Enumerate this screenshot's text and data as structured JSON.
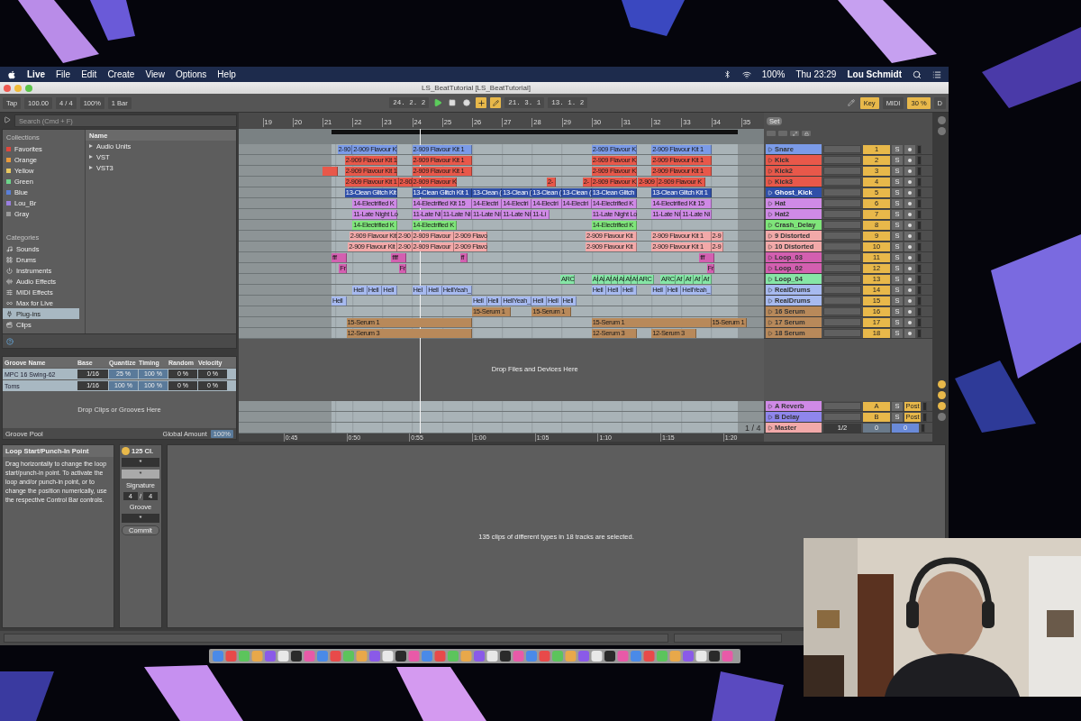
{
  "menu_bar": {
    "items": [
      "Live",
      "File",
      "Edit",
      "Create",
      "View",
      "Options",
      "Help"
    ],
    "battery": "100%",
    "clock": "Thu 23:29",
    "user": "Lou Schmidt"
  },
  "window": {
    "title": "LS_BeatTutorial  [LS_BeatTutorial]"
  },
  "control_bar": {
    "tap": "Tap",
    "tempo": "100.00",
    "signature": "4 / 4",
    "zoom": "100%",
    "quantize": "1 Bar",
    "position": "24. 2. 2",
    "loop_start": "21. 3. 1",
    "loop_length": "13. 1. 2",
    "key": "Key",
    "midi": "MIDI",
    "cpu": "30 %",
    "disk": "D"
  },
  "browser": {
    "search": {
      "placeholder": "Search (Cmd + F)"
    },
    "collections_title": "Collections",
    "collections": [
      {
        "label": "Favorites",
        "color": "#e0473c"
      },
      {
        "label": "Orange",
        "color": "#e89a3c"
      },
      {
        "label": "Yellow",
        "color": "#e8c860"
      },
      {
        "label": "Green",
        "color": "#6cd58a"
      },
      {
        "label": "Blue",
        "color": "#5a7fd8"
      },
      {
        "label": "Lou_Br",
        "color": "#9a7fe0"
      },
      {
        "label": "Gray",
        "color": "#9a9a9a"
      }
    ],
    "categories_title": "Categories",
    "categories": [
      {
        "label": "Sounds",
        "selected": false
      },
      {
        "label": "Drums",
        "selected": false
      },
      {
        "label": "Instruments",
        "selected": false
      },
      {
        "label": "Audio Effects",
        "selected": false
      },
      {
        "label": "MIDI Effects",
        "selected": false
      },
      {
        "label": "Max for Live",
        "selected": false
      },
      {
        "label": "Plug-ins",
        "selected": true
      },
      {
        "label": "Clips",
        "selected": false
      }
    ],
    "name_header": "Name",
    "items": [
      "Audio Units",
      "VST",
      "VST3"
    ]
  },
  "groove_pool": {
    "columns": [
      "Groove Name",
      "Base",
      "Quantize",
      "Timing",
      "Random",
      "Velocity"
    ],
    "rows": [
      {
        "name": "MPC 16 Swing-62",
        "base": "1/16",
        "quantize": "25 %",
        "timing": "100 %",
        "random": "0 %",
        "velocity": "0 %"
      },
      {
        "name": "Toms",
        "base": "1/16",
        "quantize": "100 %",
        "timing": "100 %",
        "random": "0 %",
        "velocity": "0 %"
      }
    ],
    "drop_hint": "Drop Clips or Grooves Here",
    "title": "Groove Pool",
    "global_amount_label": "Global Amount",
    "global_amount": "100%"
  },
  "arrangement": {
    "ruler": [
      "19",
      "20",
      "21",
      "22",
      "23",
      "24",
      "25",
      "26",
      "27",
      "28",
      "29",
      "30",
      "31",
      "32",
      "33",
      "34",
      "35"
    ],
    "set_button": "Set",
    "drop_hint": "Drop Files and Devices Here",
    "zoom_label": "1 / 4",
    "time_ruler": [
      "0:45",
      "0:50",
      "0:55",
      "1:00",
      "1:05",
      "1:10",
      "1:15",
      "1:20"
    ],
    "tracks": [
      {
        "name": "Snare",
        "number": "1",
        "solo": "S",
        "color": "#7b9be8",
        "clips": [
          {
            "name": "2-90"
          },
          {
            "name": "2-909 Flavour K"
          },
          {
            "name": "2-909 Flavour Kit 1"
          },
          {
            "name": "2-909 Flavour K"
          },
          {
            "name": "2-909 Flavour Kit 1"
          }
        ]
      },
      {
        "name": "Kick",
        "number": "2",
        "solo": "S",
        "color": "#e8584a",
        "clips": [
          {
            "name": "2-909 Flavour Kit 1"
          },
          {
            "name": "2-909 Flavour Kit 1"
          },
          {
            "name": "2-909 Flavour K"
          },
          {
            "name": "2-909 Flavour Kit 1"
          }
        ]
      },
      {
        "name": "Kick2",
        "number": "3",
        "solo": "S",
        "color": "#e8584a",
        "clips": [
          {
            "kind": "blank"
          },
          {
            "kind": "named",
            "name": "2-909 Flavour Kit 1"
          },
          {
            "kind": "named",
            "name": "2-909 Flavour Kit 1"
          },
          {
            "kind": "named",
            "name": "2-909 Flavour K"
          },
          {
            "kind": "named",
            "name": "2-909 Flavour Kit 1"
          }
        ]
      },
      {
        "name": "Kick3",
        "number": "4",
        "solo": "S",
        "color": "#e8584a",
        "clips": [
          {
            "name": "2-909 Flavour Kit 1"
          },
          {
            "name": "2-90"
          },
          {
            "name": "2-909 Flavour K"
          },
          {
            "name": "2-"
          },
          {
            "name": "2-"
          },
          {
            "name": "2-909 Flavour K"
          },
          {
            "name": "2-909"
          },
          {
            "name": "2-909 Flavour K"
          }
        ]
      },
      {
        "name": "Ghost_Kick",
        "number": "5",
        "solo": "S",
        "color": "#2f4fa8",
        "clips": [
          {
            "name": "13-Clean Glitch Kit"
          },
          {
            "name": "13-Clean Glitch Kit 1"
          },
          {
            "name": "13-Clean ("
          },
          {
            "name": "13-Clean ("
          },
          {
            "name": "13-Clean ("
          },
          {
            "name": "13-Clean ("
          },
          {
            "name": "13-Clean Glitch"
          },
          {
            "name": "13-Clean Glitch Kit 1"
          }
        ]
      },
      {
        "name": "Hat",
        "number": "6",
        "solo": "S",
        "color": "#cf8ae6",
        "clips": [
          {
            "name": "14-Electrified K"
          },
          {
            "name": "14-Electrified Kit 15"
          },
          {
            "name": "14-Electri"
          },
          {
            "name": "14-Electri"
          },
          {
            "name": "14-Electri"
          },
          {
            "name": "14-Electri"
          },
          {
            "name": "14-Electrified K"
          },
          {
            "name": "14-Electrified Kit 15"
          }
        ]
      },
      {
        "name": "Hat2",
        "number": "7",
        "solo": "S",
        "color": "#cf8ae6",
        "clips": [
          {
            "name": "11-Late Night Lo"
          },
          {
            "name": "11-Late Ni"
          },
          {
            "name": "11-Late Ni"
          },
          {
            "name": "11-Late Ni"
          },
          {
            "name": "11-Late Ni"
          },
          {
            "name": "11-Li"
          },
          {
            "name": "11-Late Night Lo"
          },
          {
            "name": "11-Late Ni"
          },
          {
            "name": "11-Late Ni"
          }
        ]
      },
      {
        "name": "Crash_Delay",
        "number": "8",
        "solo": "S",
        "color": "#7fe57a",
        "clips": [
          {
            "name": "14-Electrified K"
          },
          {
            "name": "14-Electrified K"
          },
          {
            "name": "14-Electrified K"
          }
        ]
      },
      {
        "name": "9 Distorted",
        "number": "9",
        "solo": "S",
        "color": "#f2a9a9",
        "clips": [
          {
            "name": "2-909 Flavour Kit"
          },
          {
            "name": "2-90"
          },
          {
            "name": "2-909 Flavour"
          },
          {
            "name": "2-909 Flavo"
          },
          {
            "name": "2-909 Flavour Kit"
          },
          {
            "name": "2-909 Flavour Kit 1"
          },
          {
            "name": "2-9"
          }
        ]
      },
      {
        "name": "10 Distorted",
        "number": "10",
        "solo": "S",
        "color": "#f2a9a9",
        "clips": [
          {
            "name": "2-909 Flavour Kit"
          },
          {
            "name": "2-90"
          },
          {
            "name": "2-909 Flavour"
          },
          {
            "name": "2-909 Flavo"
          },
          {
            "name": "2-909 Flavour Kit"
          },
          {
            "name": "2-909 Flavour Kit 1"
          },
          {
            "name": "2-9"
          }
        ]
      },
      {
        "name": "Loop_03",
        "number": "11",
        "solo": "S",
        "color": "#d35fb0",
        "clips": [
          {
            "name": "fff"
          },
          {
            "name": "ffff"
          },
          {
            "name": "ff"
          },
          {
            "name": "fff"
          }
        ]
      },
      {
        "name": "Loop_02",
        "number": "12",
        "solo": "S",
        "color": "#d35fb0",
        "clips": [
          {
            "name": "Fr"
          },
          {
            "name": "Fr"
          },
          {
            "name": "Fr"
          }
        ]
      },
      {
        "name": "Loop_04",
        "number": "13",
        "solo": "S",
        "color": "#86e6a6",
        "clips": [
          {
            "name": "ARC"
          },
          {
            "name": "Af"
          },
          {
            "name": "Af"
          },
          {
            "name": "Af"
          },
          {
            "name": "Af"
          },
          {
            "name": "Af"
          },
          {
            "name": "Af"
          },
          {
            "name": "Af"
          },
          {
            "name": "ARC"
          },
          {
            "name": "ARC"
          },
          {
            "name": "Af"
          },
          {
            "name": "Af"
          },
          {
            "name": "Af"
          },
          {
            "name": "Af"
          }
        ]
      },
      {
        "name": "RealDrums",
        "number": "14",
        "solo": "S",
        "color": "#a7baf0",
        "clips": [
          {
            "name": "Hell"
          },
          {
            "name": "Hell"
          },
          {
            "name": "Hell"
          },
          {
            "name": "Hel"
          },
          {
            "name": "Hell"
          },
          {
            "name": "HellYeah_"
          },
          {
            "name": "Hell"
          },
          {
            "name": "Hell"
          },
          {
            "name": "Hell"
          },
          {
            "name": "Hell"
          },
          {
            "name": "Hell"
          },
          {
            "name": "HellYeah_"
          }
        ]
      },
      {
        "name": "RealDrums",
        "number": "15",
        "solo": "S",
        "color": "#a7baf0",
        "clips": [
          {
            "name": "Hell"
          },
          {
            "name": "Hell"
          },
          {
            "name": "Hell"
          },
          {
            "name": "HellYeah_"
          },
          {
            "name": "Hell"
          },
          {
            "name": "Hell"
          },
          {
            "name": "Hell"
          }
        ]
      },
      {
        "name": "16 Serum",
        "number": "16",
        "solo": "S",
        "color": "#b8895a",
        "clips": [
          {
            "name": "15-Serum 1"
          },
          {
            "name": "15-Serum 1"
          }
        ]
      },
      {
        "name": "17 Serum",
        "number": "17",
        "solo": "S",
        "color": "#b8895a",
        "clips": [
          {
            "name": "15-Serum 1"
          },
          {
            "name": "15-Serum 1"
          },
          {
            "name": "15-Serum 1"
          }
        ]
      },
      {
        "name": "18 Serum",
        "number": "18",
        "solo": "S",
        "color": "#b8895a",
        "clips": [
          {
            "name": "12-Serum 3"
          },
          {
            "name": "12-Serum 3"
          },
          {
            "name": "12-Serum 3"
          }
        ]
      }
    ],
    "returns": [
      {
        "kind": "return",
        "name": "A Reverb",
        "letter": "A",
        "solo": "S",
        "send": "Post",
        "color": "#cf8ae6"
      },
      {
        "kind": "return",
        "name": "B Delay",
        "letter": "B",
        "solo": "S",
        "send": "Post",
        "color": "#8f86ec"
      },
      {
        "kind": "master",
        "name": "Master",
        "output": "1/2",
        "volume": "0",
        "pan": "0",
        "color": "#f2a9a9"
      }
    ]
  },
  "info": {
    "title": "Loop Start/Punch-In Point",
    "text": "Drag horizontally to change the loop start/punch-in point. To activate the loop and/or punch-in point, or to change the position numerically, use the respective Control Bar controls."
  },
  "clip_panel": {
    "title": "125 Cl.",
    "field": "*",
    "dropdown": "*",
    "signature_label": "Signature",
    "numerator": "4",
    "separator": "/",
    "denominator": "4",
    "groove_label": "Groove",
    "groove": "*",
    "commit": "Commit"
  },
  "detail": {
    "message": "135 clips of different types in 18 tracks are selected."
  }
}
